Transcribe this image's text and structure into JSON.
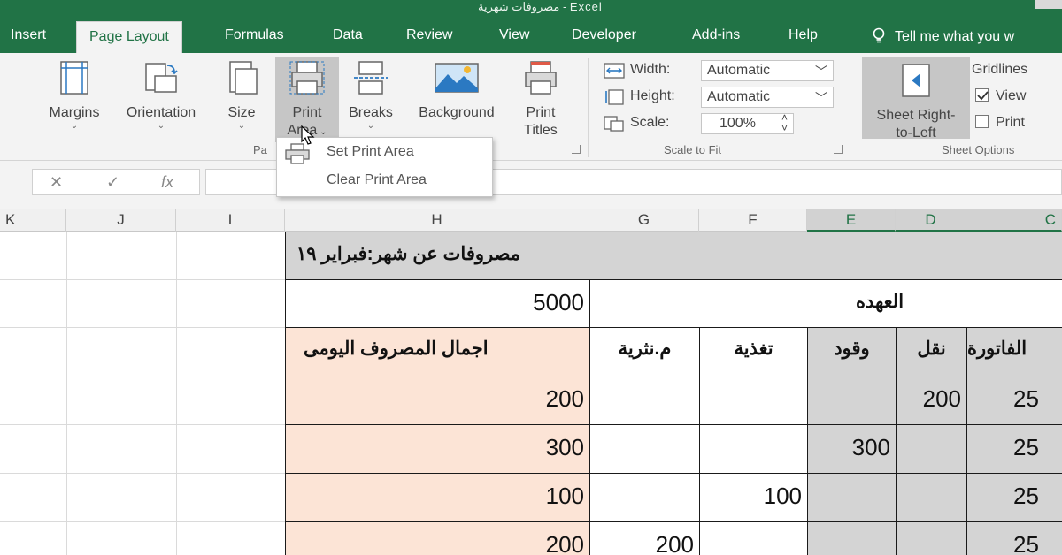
{
  "window": {
    "title": "مصروفات شهرية - Excel"
  },
  "tabs": [
    {
      "label": "Insert"
    },
    {
      "label": "Page Layout"
    },
    {
      "label": "Formulas"
    },
    {
      "label": "Data"
    },
    {
      "label": "Review"
    },
    {
      "label": "View"
    },
    {
      "label": "Developer"
    },
    {
      "label": "Add-ins"
    },
    {
      "label": "Help"
    }
  ],
  "tell_me": "Tell me what you w",
  "ribbon": {
    "page_setup": {
      "margins": "Margins",
      "orientation": "Orientation",
      "size": "Size",
      "print_area_l1": "Print",
      "print_area_l2": "Area",
      "breaks": "Breaks",
      "background": "Background",
      "print_titles_l1": "Print",
      "print_titles_l2": "Titles",
      "group_label": "Pa"
    },
    "scale_to_fit": {
      "width_label": "Width:",
      "width_value": "Automatic",
      "height_label": "Height:",
      "height_value": "Automatic",
      "scale_label": "Scale:",
      "scale_value": "100%",
      "group_label": "Scale to Fit"
    },
    "sheet_options": {
      "sheet_rtl_l1": "Sheet Right-",
      "sheet_rtl_l2": "to-Left",
      "gridlines_label": "Gridlines",
      "view_label": "View",
      "print_label": "Print",
      "group_label": "Sheet Options"
    }
  },
  "print_area_menu": {
    "set": "Set Print Area",
    "clear": "Clear Print Area"
  },
  "formula_bar": {
    "cancel": "✕",
    "enter": "✓",
    "fx": "fx"
  },
  "columns": [
    "K",
    "J",
    "I",
    "H",
    "G",
    "F",
    "E",
    "D",
    "C"
  ],
  "sheet": {
    "title": "مصروفات عن شهر:فبراير ١٩",
    "custody_value": "5000",
    "custody_label": "العهده",
    "headers": {
      "total": "اجمال المصروف اليومى",
      "misc": "م.نثرية",
      "food": "تغذية",
      "fuel": "وقود",
      "transport": "نقل",
      "invoice": "الفاتورة"
    },
    "rows": [
      {
        "total": "200",
        "misc": "",
        "food": "",
        "fuel": "",
        "transport": "200",
        "invoice": "25"
      },
      {
        "total": "300",
        "misc": "",
        "food": "",
        "fuel": "300",
        "transport": "",
        "invoice": "25"
      },
      {
        "total": "100",
        "misc": "",
        "food": "100",
        "fuel": "",
        "transport": "",
        "invoice": "25"
      },
      {
        "total": "200",
        "misc": "200",
        "food": "",
        "fuel": "",
        "transport": "",
        "invoice": "25"
      }
    ]
  },
  "colors": {
    "excel_green": "#217346",
    "ribbon_bg": "#f3f3f3",
    "peach": "#fce4d6",
    "gray_fill": "#d4d4d4"
  }
}
